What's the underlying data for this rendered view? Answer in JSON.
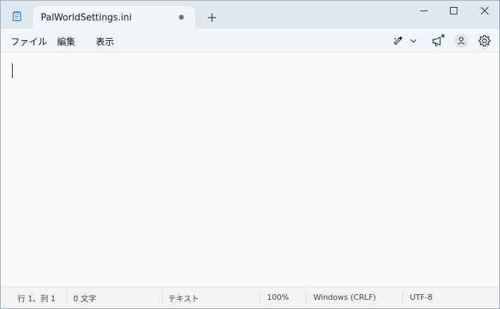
{
  "tab": {
    "title": "PalWorldSettings.ini",
    "unsaved_indicator": "●"
  },
  "window_controls": [
    "minimize",
    "maximize",
    "close"
  ],
  "menu": {
    "file": "ファイル",
    "edit": "編集",
    "view": "表示"
  },
  "toolbar_icons": [
    "copilot-icon",
    "chevron-down-icon",
    "megaphone-icon",
    "account-icon",
    "gear-icon"
  ],
  "status": {
    "position": "行 1、列 1",
    "chars": "0 文字",
    "format": "テキスト",
    "zoom": "100%",
    "line_ending": "Windows (CRLF)",
    "encoding": "UTF-8"
  },
  "colors": {
    "titlebar": "#dfe7ef",
    "accent": "#1a6fd6"
  }
}
